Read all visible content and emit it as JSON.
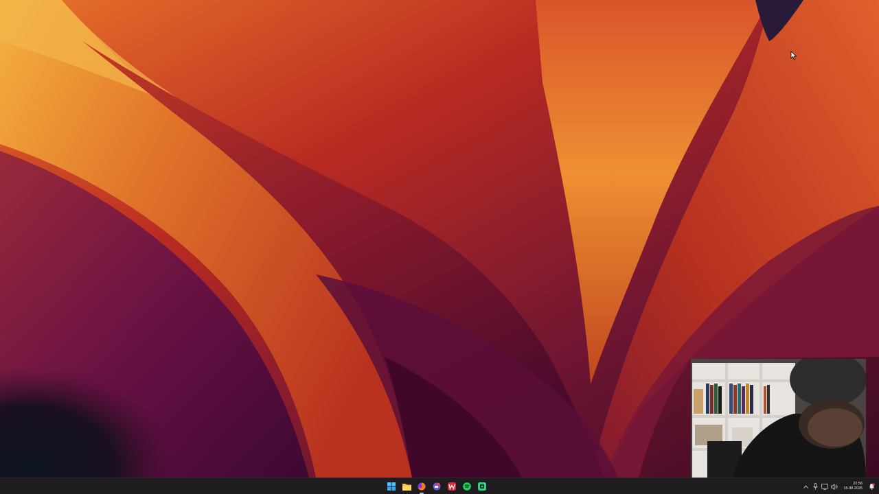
{
  "taskbar": {
    "apps": [
      {
        "name": "start",
        "icon": "windows-start-icon"
      },
      {
        "name": "file-explorer",
        "icon": "folder-icon"
      },
      {
        "name": "firefox",
        "icon": "firefox-icon",
        "active": true
      },
      {
        "name": "messenger",
        "icon": "chat-app-icon"
      },
      {
        "name": "wps",
        "icon": "w-app-icon"
      },
      {
        "name": "spotify",
        "icon": "spotify-icon"
      },
      {
        "name": "screen-recorder",
        "icon": "recorder-app-icon"
      }
    ],
    "tray": {
      "time": "22:56",
      "date": "15.08.2025"
    }
  },
  "colors": {
    "taskbar_bg": "#1f1c20",
    "wallpaper_orange": "#f29a2e",
    "wallpaper_red": "#b8261f",
    "wallpaper_purple": "#6a1244"
  }
}
